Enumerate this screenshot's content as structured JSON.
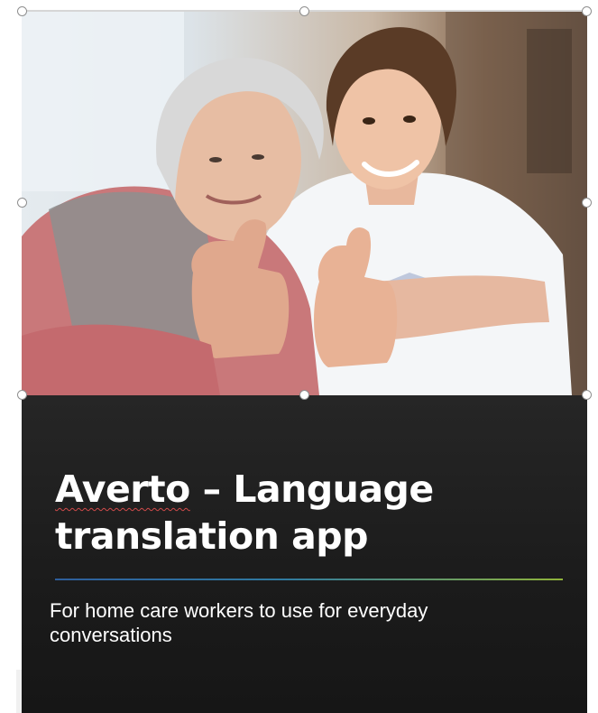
{
  "slide": {
    "title_part1": "Averto",
    "title_part2": " – Language translation app",
    "subtitle": "For home care workers to use for everyday conversations"
  },
  "photo": {
    "alt": "Elderly woman and young nurse giving thumbs up"
  },
  "colors": {
    "card_background": "#1b1b1b",
    "accent_rule_start": "#2e5e9c",
    "accent_rule_end": "#8fb33a",
    "title_text": "#ffffff"
  }
}
